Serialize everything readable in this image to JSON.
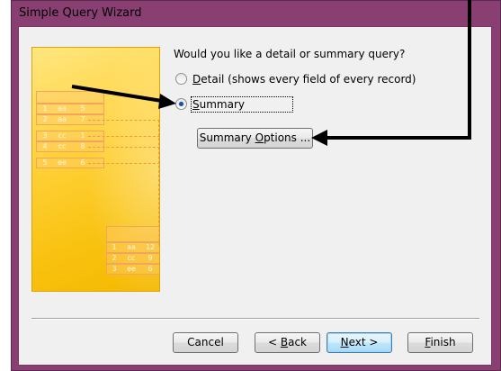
{
  "window": {
    "title": "Simple Query Wizard"
  },
  "question": "Would you like a detail or summary query?",
  "options": [
    {
      "label": "Detail (shows every field of every record)",
      "mnemonic": "D",
      "rest": "etail (shows every field of every record)",
      "checked": false
    },
    {
      "label": "Summary",
      "mnemonic": "S",
      "rest": "ummary",
      "checked": true
    }
  ],
  "summary_options_button": {
    "pre": "Summary ",
    "mnemonic": "O",
    "rest": "ptions ..."
  },
  "footer_buttons": {
    "cancel": "Cancel",
    "back": {
      "pre": "< ",
      "mnemonic": "B",
      "rest": "ack"
    },
    "next": {
      "mnemonic": "N",
      "rest": "ext >"
    },
    "finish": {
      "mnemonic": "F",
      "rest": "inish"
    }
  },
  "illustration": {
    "top_rows": [
      [
        "1",
        "aa",
        "5"
      ],
      [
        "2",
        "aa",
        "7"
      ],
      [
        "3",
        "cc",
        "1"
      ],
      [
        "4",
        "cc",
        "8"
      ],
      [
        "5",
        "ee",
        "6"
      ]
    ],
    "result_rows": [
      [
        "1",
        "aa",
        "12"
      ],
      [
        "2",
        "cc",
        "9"
      ],
      [
        "3",
        "ee",
        "6"
      ]
    ]
  }
}
